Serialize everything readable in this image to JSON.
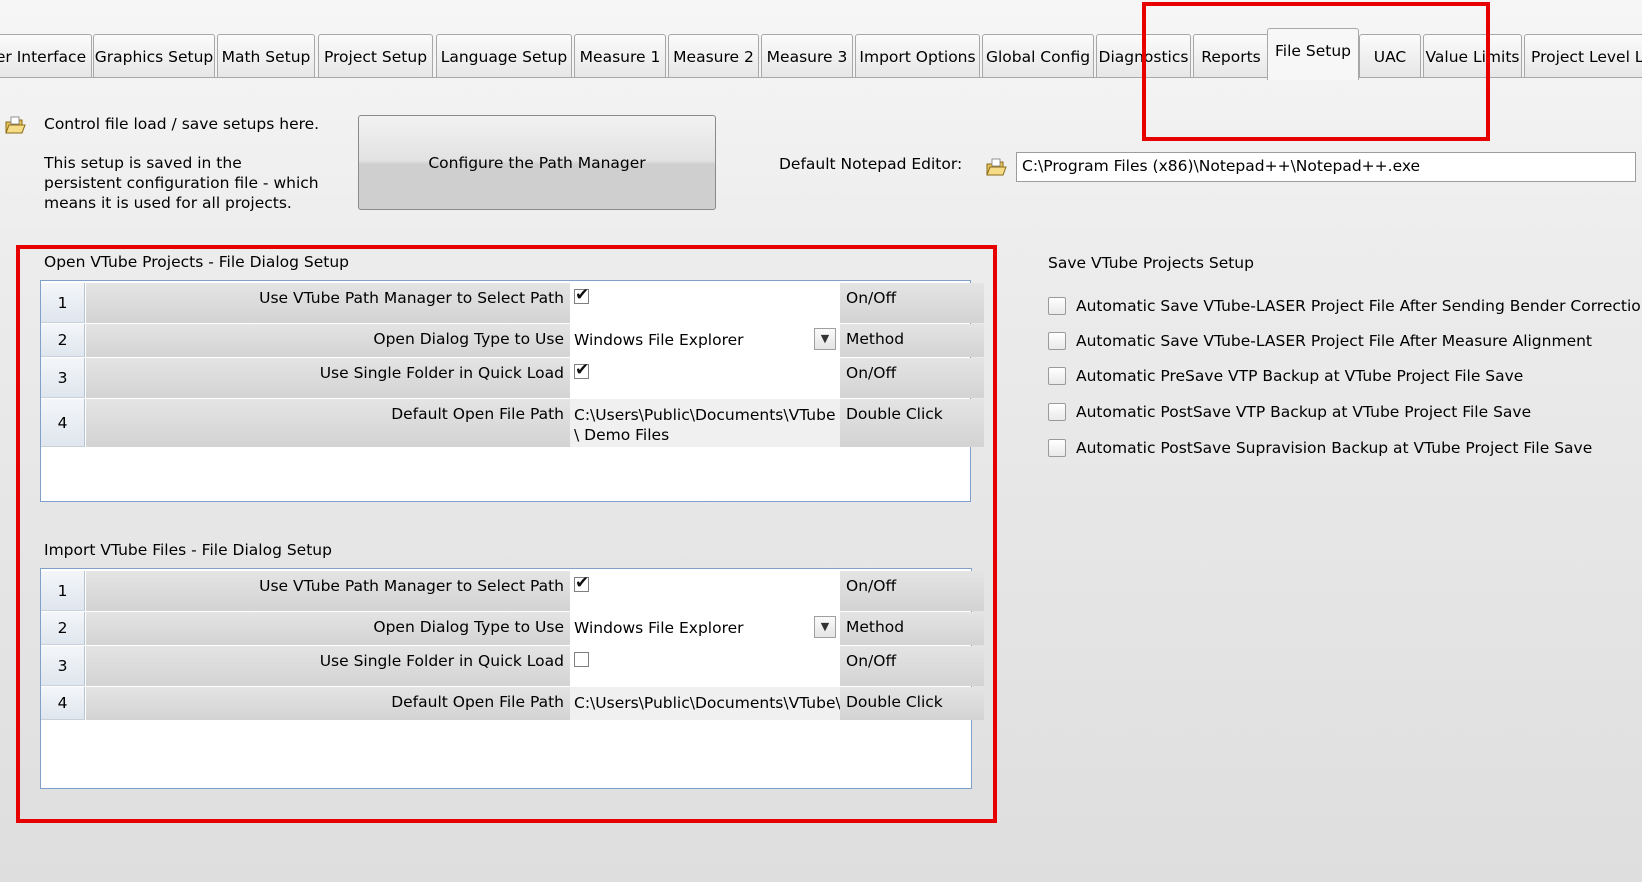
{
  "tabs": [
    {
      "label": "er Interface"
    },
    {
      "label": "Graphics Setup"
    },
    {
      "label": "Math Setup"
    },
    {
      "label": "Project Setup"
    },
    {
      "label": "Language Setup"
    },
    {
      "label": "Measure 1"
    },
    {
      "label": "Measure 2"
    },
    {
      "label": "Measure 3"
    },
    {
      "label": "Import Options"
    },
    {
      "label": "Global Config"
    },
    {
      "label": "Diagnostics"
    },
    {
      "label": "Reports"
    },
    {
      "label": "File Setup"
    },
    {
      "label": "UAC"
    },
    {
      "label": "Value Limits"
    },
    {
      "label": "Project Level Lis"
    }
  ],
  "info": {
    "line1": "Control file load / save setups here.",
    "line2": "This setup is saved in the persistent configuration file - which means it is used for all projects."
  },
  "path_manager_button": "Configure the Path Manager",
  "notepad": {
    "label": "Default Notepad Editor:",
    "value": "C:\\Program Files (x86)\\Notepad++\\Notepad++.exe"
  },
  "open_section": {
    "title": "Open VTube Projects - File Dialog Setup",
    "rows": [
      {
        "num": "1",
        "label": "Use VTube Path Manager to Select Path",
        "checked": true,
        "hint": "On/Off"
      },
      {
        "num": "2",
        "label": "Open Dialog Type to Use",
        "value": "Windows File Explorer",
        "hint": "Method"
      },
      {
        "num": "3",
        "label": "Use Single Folder in Quick Load",
        "checked": true,
        "hint": "On/Off"
      },
      {
        "num": "4",
        "label": "Default Open File Path",
        "value": "C:\\Users\\Public\\Documents\\VTube\\ Demo Files",
        "hint": "Double Click"
      }
    ]
  },
  "import_section": {
    "title": "Import VTube Files - File Dialog Setup",
    "rows": [
      {
        "num": "1",
        "label": "Use VTube Path Manager to Select Path",
        "checked": true,
        "hint": "On/Off"
      },
      {
        "num": "2",
        "label": "Open Dialog Type to Use",
        "value": "Windows File Explorer",
        "hint": "Method"
      },
      {
        "num": "3",
        "label": "Use Single Folder in Quick Load",
        "checked": false,
        "hint": "On/Off"
      },
      {
        "num": "4",
        "label": "Default Open File Path",
        "value": "C:\\Users\\Public\\Documents\\VTube\\",
        "hint": "Double Click"
      }
    ]
  },
  "save_section": {
    "title": "Save VTube Projects Setup",
    "items": [
      {
        "label": "Automatic Save VTube-LASER Project File After Sending Bender Correction",
        "checked": false
      },
      {
        "label": "Automatic Save VTube-LASER Project File After Measure Alignment",
        "checked": false
      },
      {
        "label": "Automatic PreSave VTP Backup at VTube Project File Save",
        "checked": false
      },
      {
        "label": "Automatic PostSave VTP Backup at VTube Project File Save",
        "checked": false
      },
      {
        "label": "Automatic PostSave Supravision Backup at VTube Project File Save",
        "checked": false
      }
    ]
  },
  "colors": {
    "highlight": "#e60000",
    "grid_border": "#7fa0c8"
  },
  "icons": {
    "folder": "folder-open-icon"
  }
}
